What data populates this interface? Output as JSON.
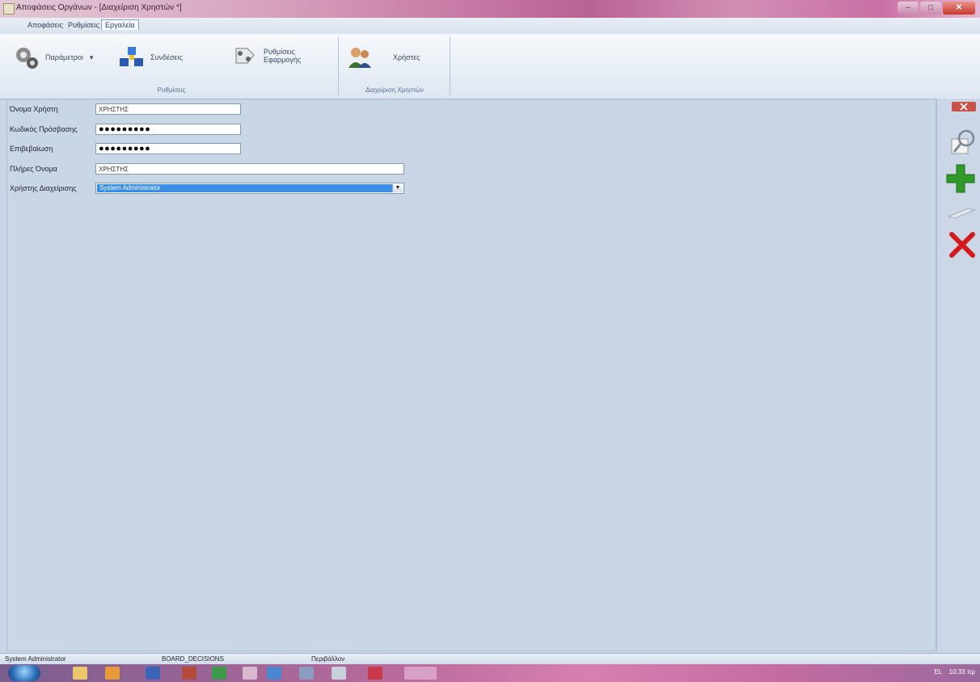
{
  "window": {
    "title": "Αποφάσεις Οργάνων - [Διαχείριση Χρηστών *]",
    "controls": {
      "minimize": "–",
      "maximize": "□",
      "close": "✕"
    }
  },
  "menu": {
    "tabs": [
      {
        "label": "Αποφάσεις"
      },
      {
        "label": "Ρυθμίσεις"
      },
      {
        "label": "Εργαλεία"
      }
    ]
  },
  "ribbon": {
    "settings_group": {
      "caption": "Ρυθμίσεις",
      "parameters_label": "Παράμετροι",
      "parameters_dropdown": "▾",
      "connection_label": "Συνδέσεις",
      "app_settings_label_1": "Ρυθμίσεις",
      "app_settings_label_2": "Εφαρμογής"
    },
    "users_group": {
      "caption": "Διαχείριση Χρηστών",
      "users_label": "Χρήστες"
    }
  },
  "form": {
    "username_label": "Όνομα Χρήστη",
    "username_value": "ΧΡΗΣΤΗΣ",
    "password_label": "Κωδικός Πρόσβασης",
    "password_value": "●●●●●●●●●",
    "confirm_label": "Επιβεβαίωση",
    "confirm_value": "●●●●●●●●●",
    "fullname_label": "Πλήρες Όνομα",
    "fullname_value": "ΧΡΗΣΤΗΣ",
    "admin_label": "Χρήστης Διαχείρισης",
    "admin_value": "System Administrator",
    "admin_arrow": "▼"
  },
  "toolbar": {
    "icons": [
      "window-close-icon",
      "search-icon",
      "add-icon",
      "edit-icon",
      "delete-icon"
    ]
  },
  "status": {
    "user": "System Administrator",
    "database": "BOARD_DECISIONS",
    "section": "Περιβάλλον"
  },
  "taskbar": {
    "tray_language": "EL",
    "tray_clock": "10:33 πμ"
  },
  "colors": {
    "background": "#c9d6e6",
    "selection": "#3a8ee6",
    "add_green": "#2f9a2a",
    "delete_red": "#d41b1b"
  }
}
